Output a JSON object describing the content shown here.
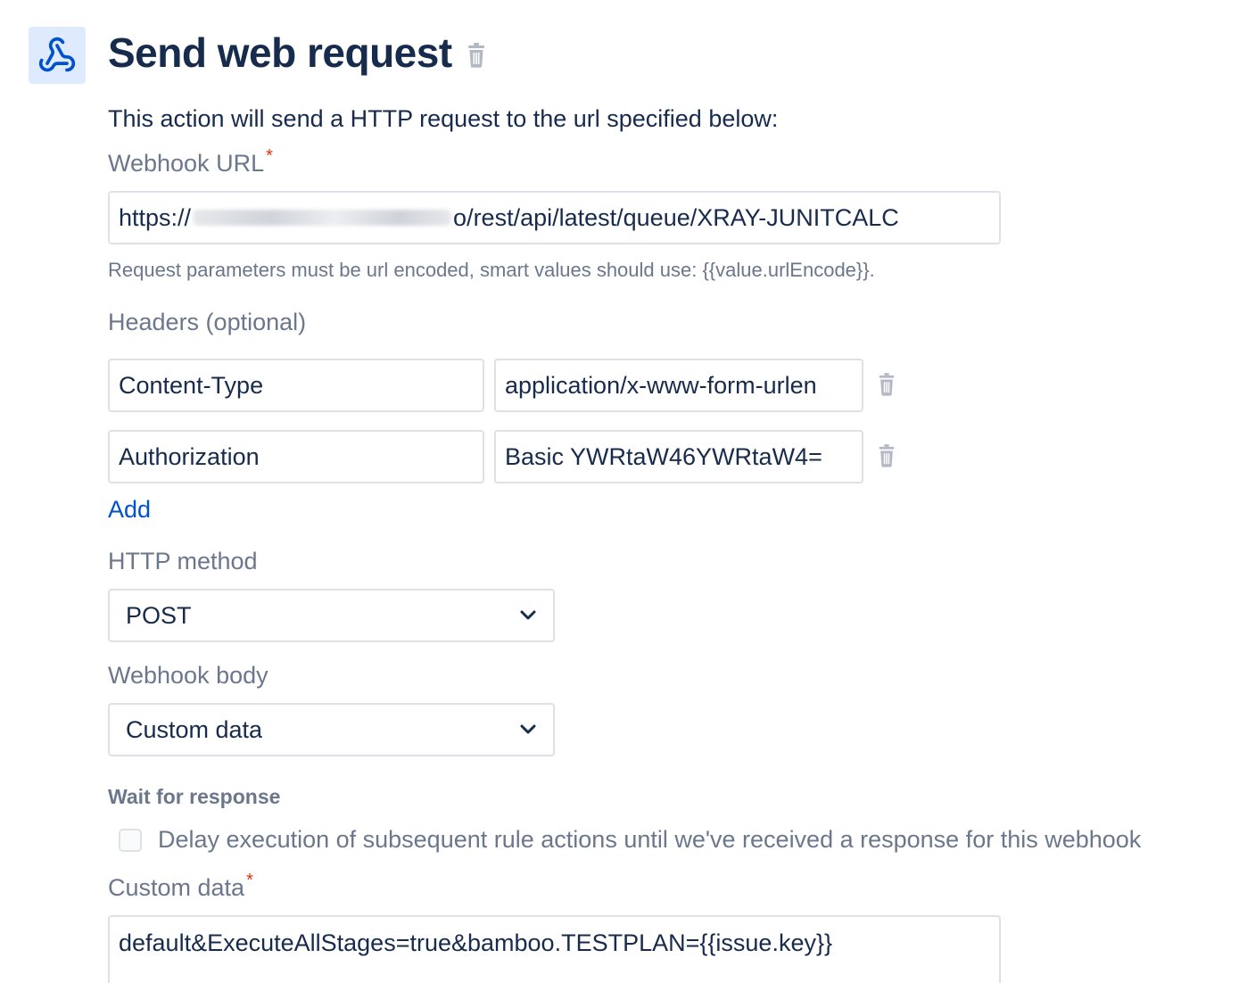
{
  "header": {
    "title": "Send web request",
    "icon": "webhook-icon",
    "accent_color": "#0052cc",
    "icon_bg_color": "#deebff"
  },
  "description": "This action will send a HTTP request to the url specified below:",
  "webhook_url": {
    "label": "Webhook URL",
    "required_mark": "*",
    "value_prefix": "https://",
    "value_suffix": "o/rest/api/latest/queue/XRAY-JUNITCALC",
    "hint": "Request parameters must be url encoded, smart values should use: {{value.urlEncode}}."
  },
  "headers": {
    "label": "Headers (optional)",
    "rows": [
      {
        "key": "Content-Type",
        "value": "application/x-www-form-urlen"
      },
      {
        "key": "Authorization",
        "value": "Basic YWRtaW46YWRtaW4="
      }
    ],
    "add_label": "Add"
  },
  "http_method": {
    "label": "HTTP method",
    "selected": "POST"
  },
  "webhook_body": {
    "label": "Webhook body",
    "selected": "Custom data"
  },
  "wait_for_response": {
    "title": "Wait for response",
    "checkbox_label": "Delay execution of subsequent rule actions until we've received a response for this webhook",
    "checked": false
  },
  "custom_data": {
    "label": "Custom data",
    "required_mark": "*",
    "value": "default&ExecuteAllStages=true&bamboo.TESTPLAN={{issue.key}}"
  }
}
